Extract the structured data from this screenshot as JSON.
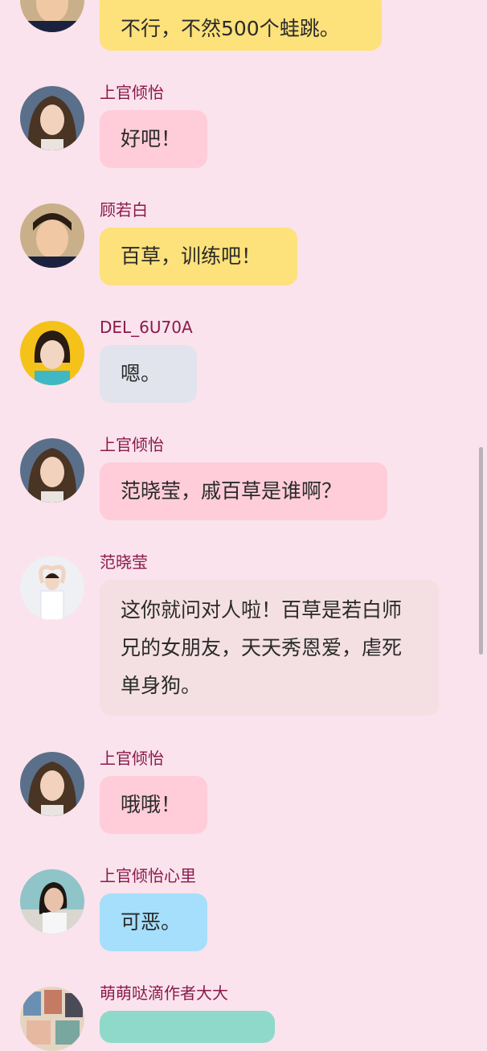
{
  "messages": [
    {
      "name": "",
      "text": "不行，不然500个蛙跳。",
      "bubble_color": "#fde17a",
      "avatar": "boy-avatar"
    },
    {
      "name": "上官倾怡",
      "text": "好吧！",
      "bubble_color": "#fecdd9",
      "avatar": "girl-longhair-avatar"
    },
    {
      "name": "顾若白",
      "text": "百草，训练吧！",
      "bubble_color": "#fde17a",
      "avatar": "boy-avatar"
    },
    {
      "name": "DEL_6U70A",
      "text": "嗯。",
      "bubble_color": "#e1e4ec",
      "avatar": "girl-yellow-bg-avatar"
    },
    {
      "name": "上官倾怡",
      "text": "范晓莹，戚百草是谁啊？",
      "bubble_color": "#fecdd9",
      "avatar": "girl-longhair-avatar"
    },
    {
      "name": "范晓莹",
      "text": "这你就问对人啦！百草是若白师兄的女朋友，天天秀恩爱，虐死单身狗。",
      "bubble_color": "#f4e0e3",
      "avatar": "girl-heart-pose-avatar"
    },
    {
      "name": "上官倾怡",
      "text": "哦哦！",
      "bubble_color": "#fecdd9",
      "avatar": "girl-longhair-avatar"
    },
    {
      "name": "上官倾怡心里",
      "text": "可恶。",
      "bubble_color": "#a6dffb",
      "avatar": "girl-outdoor-avatar"
    },
    {
      "name": "萌萌哒滴作者大大",
      "text": "",
      "bubble_color": "#8fd9cb",
      "avatar": "collage-avatar"
    }
  ]
}
